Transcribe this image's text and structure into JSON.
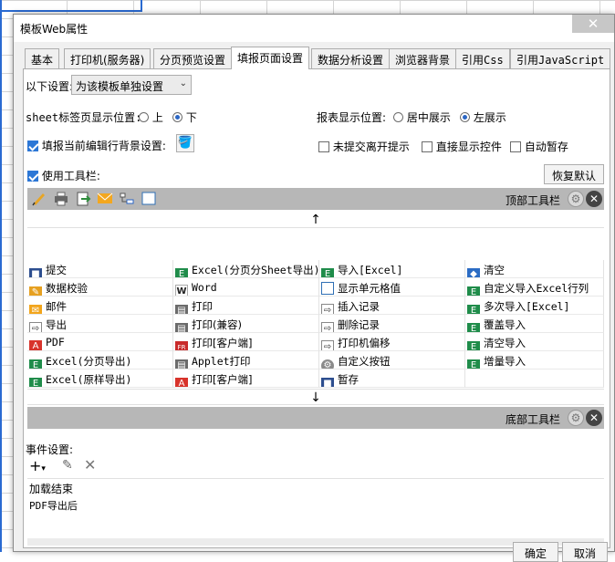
{
  "dialog": {
    "title": "模板Web属性",
    "close_symbol": "✕"
  },
  "tabs": [
    {
      "label": "基本"
    },
    {
      "label": "打印机(服务器)"
    },
    {
      "label": "分页预览设置"
    },
    {
      "label": "填报页面设置",
      "active": true
    },
    {
      "label": "数据分析设置"
    },
    {
      "label": "浏览器背景"
    },
    {
      "label": "引用Css"
    },
    {
      "label": "引用JavaScript"
    }
  ],
  "settings": {
    "scope_label": "以下设置:",
    "scope_value": "为该模板单独设置",
    "sheet_pos_label": "sheet标签页显示位置:",
    "sheet_pos_options": [
      "上",
      "下"
    ],
    "sheet_pos_selected": "下",
    "report_pos_label": "报表显示位置:",
    "report_pos_options": [
      "居中展示",
      "左展示"
    ],
    "report_pos_selected": "左展示",
    "fill_bg_label": "填报当前编辑行背景设置:",
    "fill_bg_checked": true,
    "unsubmitted_label": "未提交离开提示",
    "unsubmitted_checked": false,
    "direct_widget_label": "直接显示控件",
    "direct_widget_checked": false,
    "autosave_label": "自动暂存",
    "autosave_checked": false,
    "use_toolbar_label": "使用工具栏:",
    "use_toolbar_checked": true,
    "restore_default_label": "恢复默认"
  },
  "toolbar": {
    "top_label": "顶部工具栏",
    "bottom_label": "底部工具栏",
    "up_arrow": "↑",
    "down_arrow": "↓"
  },
  "buttons_grid": [
    {
      "label": "提交",
      "icon": "save"
    },
    {
      "label": "Excel(分页分Sheet导出)",
      "icon": "excel"
    },
    {
      "label": "导入[Excel]",
      "icon": "excel"
    },
    {
      "label": "清空",
      "icon": "clear"
    },
    {
      "label": "数据校验",
      "icon": "edit"
    },
    {
      "label": "Word",
      "icon": "word"
    },
    {
      "label": "显示单元格值",
      "icon": "grid2"
    },
    {
      "label": "自定义导入Excel行列",
      "icon": "excel"
    },
    {
      "label": "邮件",
      "icon": "mail"
    },
    {
      "label": "打印",
      "icon": "print"
    },
    {
      "label": "插入记录",
      "icon": "arrow"
    },
    {
      "label": "多次导入[Excel]",
      "icon": "excel"
    },
    {
      "label": "导出",
      "icon": "arrow"
    },
    {
      "label": "打印(兼容)",
      "icon": "print"
    },
    {
      "label": "删除记录",
      "icon": "arrow"
    },
    {
      "label": "覆盖导入",
      "icon": "excel"
    },
    {
      "label": "PDF",
      "icon": "pdf"
    },
    {
      "label": "打印[客户端]",
      "icon": "fr"
    },
    {
      "label": "打印机偏移",
      "icon": "arrow"
    },
    {
      "label": "清空导入",
      "icon": "excel"
    },
    {
      "label": "Excel(分页导出)",
      "icon": "excel"
    },
    {
      "label": "Applet打印",
      "icon": "print"
    },
    {
      "label": "自定义按钮",
      "icon": "gear"
    },
    {
      "label": "增量导入",
      "icon": "excel"
    },
    {
      "label": "Excel(原样导出)",
      "icon": "excel"
    },
    {
      "label": "打印[客户端]",
      "icon": "pdf"
    },
    {
      "label": "暂存",
      "icon": "save"
    },
    {
      "label": "",
      "icon": ""
    }
  ],
  "events": {
    "label": "事件设置:",
    "items": [
      "加载结束",
      "PDF导出后"
    ]
  },
  "footer": {
    "ok_label": "确定",
    "cancel_label": "取消"
  }
}
